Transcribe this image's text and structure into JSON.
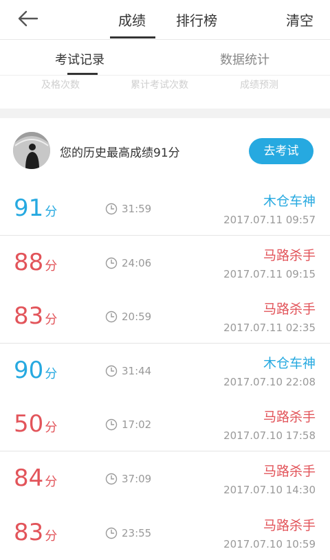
{
  "header": {
    "tabs": [
      {
        "label": "成绩",
        "active": true
      },
      {
        "label": "排行榜",
        "active": false
      }
    ],
    "clear_label": "清空"
  },
  "subtabs": [
    {
      "label": "考试记录",
      "active": true
    },
    {
      "label": "数据统计",
      "active": false
    }
  ],
  "stat_labels": [
    "及格次数",
    "累计考试次数",
    "成绩预测"
  ],
  "best": {
    "text": "您的历史最高成绩91分",
    "button_label": "去考试"
  },
  "colors": {
    "blue": "#26a9e0",
    "red": "#e2545a"
  },
  "records": [
    {
      "score": "91",
      "unit": "分",
      "duration": "31:59",
      "label": "木仓车神",
      "date": "2017.07.11  09:57",
      "tone": "blue"
    },
    {
      "score": "88",
      "unit": "分",
      "duration": "24:06",
      "label": "马路杀手",
      "date": "2017.07.11  09:15",
      "tone": "red"
    },
    {
      "score": "83",
      "unit": "分",
      "duration": "20:59",
      "label": "马路杀手",
      "date": "2017.07.11  02:35",
      "tone": "red"
    },
    {
      "score": "90",
      "unit": "分",
      "duration": "31:44",
      "label": "木仓车神",
      "date": "2017.07.10  22:08",
      "tone": "blue"
    },
    {
      "score": "50",
      "unit": "分",
      "duration": "17:02",
      "label": "马路杀手",
      "date": "2017.07.10  17:58",
      "tone": "red"
    },
    {
      "score": "84",
      "unit": "分",
      "duration": "37:09",
      "label": "马路杀手",
      "date": "2017.07.10  14:30",
      "tone": "red"
    },
    {
      "score": "83",
      "unit": "分",
      "duration": "23:55",
      "label": "马路杀手",
      "date": "2017.07.10  10:59",
      "tone": "red"
    }
  ]
}
